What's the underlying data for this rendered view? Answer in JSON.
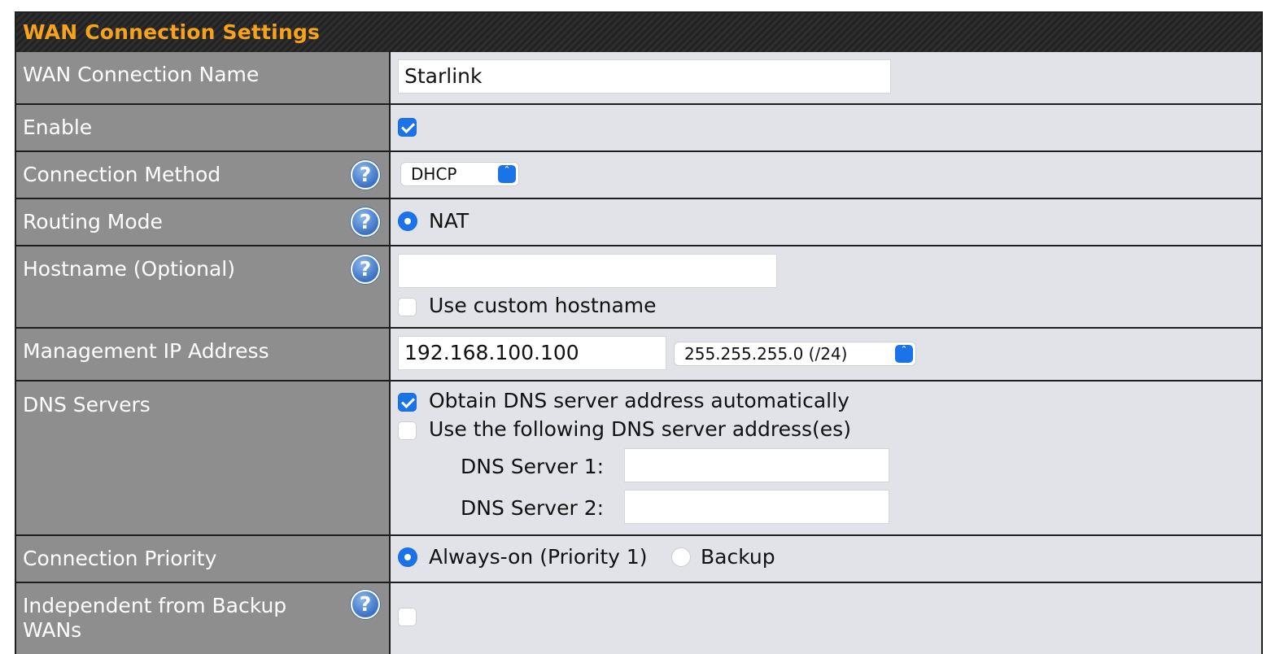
{
  "panel": {
    "title": "WAN Connection Settings"
  },
  "rows": {
    "name": {
      "label": "WAN Connection Name",
      "value": "Starlink"
    },
    "enable": {
      "label": "Enable",
      "checked": true
    },
    "method": {
      "label": "Connection Method",
      "selected": "DHCP",
      "help_icon": "question-mark-icon"
    },
    "routing": {
      "label": "Routing Mode",
      "option": "NAT",
      "help_icon": "question-mark-icon"
    },
    "hostname": {
      "label": "Hostname (Optional)",
      "value": "",
      "custom_label": "Use custom hostname",
      "custom_checked": false,
      "help_icon": "question-mark-icon"
    },
    "mgmt": {
      "label": "Management IP Address",
      "ip": "192.168.100.100",
      "mask": "255.255.255.0 (/24)"
    },
    "dns": {
      "label": "DNS Servers",
      "auto_label": "Obtain DNS server address automatically",
      "auto_checked": true,
      "manual_label": "Use the following DNS server address(es)",
      "manual_checked": false,
      "server1_label": "DNS Server 1:",
      "server1_value": "",
      "server2_label": "DNS Server 2:",
      "server2_value": ""
    },
    "priority": {
      "label": "Connection Priority",
      "option1": "Always-on (Priority 1)",
      "option2": "Backup",
      "selected": "Always-on (Priority 1)"
    },
    "independent": {
      "label": "Independent from Backup WANs",
      "checked": false,
      "help_icon": "question-mark-icon"
    }
  },
  "colors": {
    "accent": "#1a73e8",
    "title": "#f6a21b",
    "label_bg": "#8e8e8e",
    "value_bg": "#e2e2e9"
  }
}
